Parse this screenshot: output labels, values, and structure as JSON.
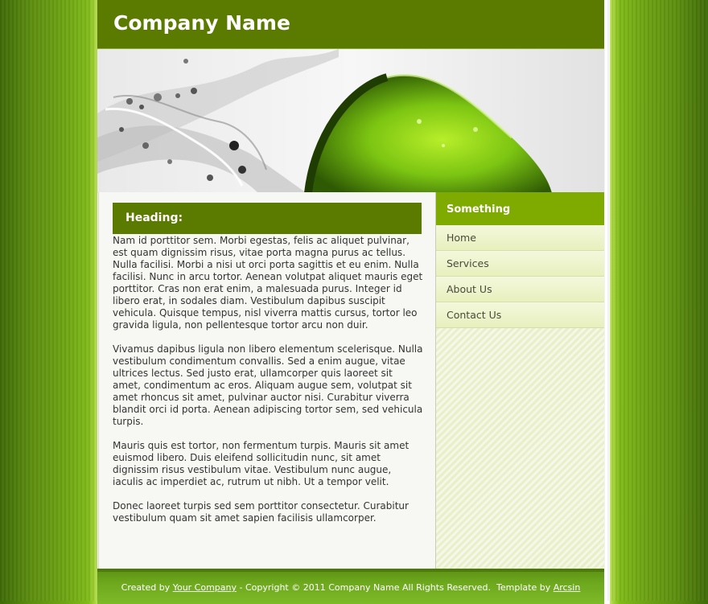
{
  "header": {
    "company_name": "Company Name"
  },
  "main": {
    "heading": "Heading:",
    "paragraphs": [
      "Nam id porttitor sem. Morbi egestas, felis ac aliquet pulvinar, est quam dignissim risus, vitae porta magna purus ac tellus. Nulla facilisi. Morbi a nisi ut orci porta sagittis et eu enim. Nulla facilisi. Nunc in arcu tortor. Aenean volutpat aliquet mauris eget porttitor. Cras non erat enim, a malesuada purus. Integer id libero erat, in sodales diam. Vestibulum dapibus suscipit vehicula. Quisque tempus, nisl viverra mattis cursus, tortor leo gravida ligula, non pellentesque tortor arcu non duir.",
      "Vivamus dapibus ligula non libero elementum scelerisque. Nulla vestibulum condimentum convallis. Sed a enim augue, vitae ultrices lectus. Sed justo erat, ullamcorper quis laoreet sit amet, condimentum ac eros. Aliquam augue sem, volutpat sit amet rhoncus sit amet, pulvinar auctor nisi. Curabitur viverra blandit orci id porta. Aenean adipiscing tortor sem, sed vehicula turpis.",
      "Mauris quis est tortor, non fermentum turpis. Mauris sit amet euismod libero. Duis eleifend sollicitudin nunc, sit amet dignissim risus vestibulum vitae. Vestibulum nunc augue, iaculis ac imperdiet ac, rutrum ut nibh. Ut a tempor velit.",
      "Donec laoreet turpis sed sem porttitor consectetur. Curabitur vestibulum quam sit amet sapien facilisis ullamcorper."
    ]
  },
  "sidebar": {
    "title": "Something",
    "items": [
      {
        "label": "Home"
      },
      {
        "label": "Services"
      },
      {
        "label": "About Us"
      },
      {
        "label": "Contact Us"
      }
    ]
  },
  "footer": {
    "created_by": "Created by ",
    "company_link": "Your Company",
    "copyright": " - Copyright © 2011 Company Name All Rights Reserved.",
    "template_by": "Template by ",
    "author_link": "Arcsin"
  },
  "colors": {
    "header_green": "#5a7a00",
    "sidebar_head_green": "#7fab00",
    "page_background": "#f7f8f3"
  },
  "banner": {
    "image": "lime-splash-photo"
  }
}
